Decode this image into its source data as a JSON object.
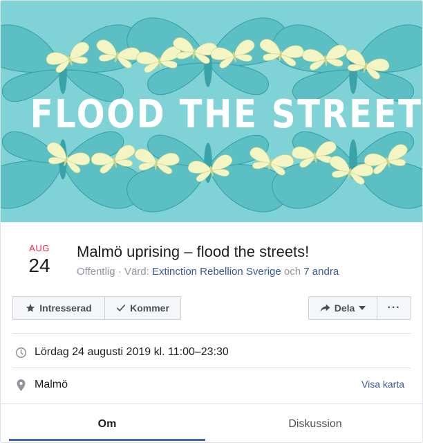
{
  "cover": {
    "title": "FLOOD THE STREETS",
    "background_color": "#7fd3d6",
    "butterfly_color": "#f3f6c4"
  },
  "event": {
    "month": "AUG",
    "day": "24",
    "title": "Malmö uprising – flood the streets!",
    "privacy": "Offentlig",
    "separator": " · ",
    "host_label": "Värd: ",
    "host_name": "Extinction Rebellion Sverige",
    "and_word": " och ",
    "others": "7 andra"
  },
  "actions": {
    "interested": "Intresserad",
    "going": "Kommer",
    "share": "Dela",
    "more": "···"
  },
  "details": {
    "datetime": "Lördag 24 augusti 2019 kl. 11:00–23:30",
    "location": "Malmö",
    "map_link": "Visa karta"
  },
  "tabs": {
    "about": "Om",
    "discussion": "Diskussion"
  },
  "icons": {
    "interested": "star-icon",
    "going": "checkmark-icon",
    "share": "share-arrow-icon",
    "share_dropdown": "caret-down-icon",
    "time": "clock-icon",
    "location": "location-pin-icon"
  },
  "colors": {
    "accent": "#4267b2",
    "link": "#365899",
    "date_month": "#f02849"
  }
}
